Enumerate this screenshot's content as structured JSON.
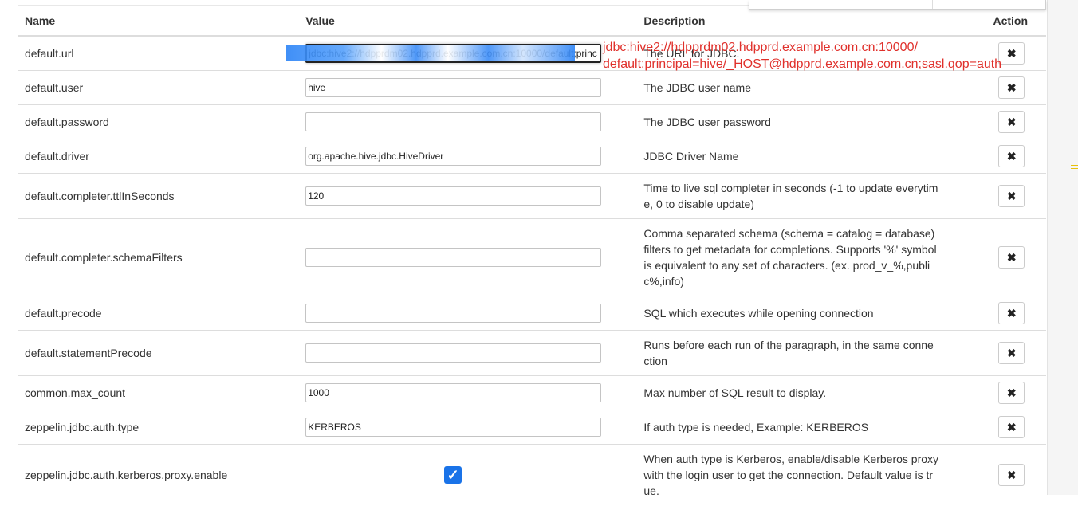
{
  "header": {
    "name": "Name",
    "value": "Value",
    "description": "Description",
    "action": "Action"
  },
  "rows": [
    {
      "name": "default.url",
      "value": "jdbc:hive2://hdpprdm02.hdpprd.example.com.cn:10000/default;princ",
      "description": "The URL for JDBC."
    },
    {
      "name": "default.user",
      "value": "hive",
      "description": "The JDBC user name"
    },
    {
      "name": "default.password",
      "value": "",
      "description": "The JDBC user password"
    },
    {
      "name": "default.driver",
      "value": "org.apache.hive.jdbc.HiveDriver",
      "description": "JDBC Driver Name"
    },
    {
      "name": "default.completer.ttlInSeconds",
      "value": "120",
      "description": "Time to live sql completer in seconds (-1 to update everytime, 0 to disable update)"
    },
    {
      "name": "default.completer.schemaFilters",
      "value": "",
      "description": "Comma separated schema (schema = catalog = database) filters to get metadata for completions. Supports '%' symbol is equivalent to any set of characters. (ex. prod_v_%,public%,info)"
    },
    {
      "name": "default.precode",
      "value": "",
      "description": "SQL which executes while opening connection"
    },
    {
      "name": "default.statementPrecode",
      "value": "",
      "description": "Runs before each run of the paragraph, in the same connection"
    },
    {
      "name": "common.max_count",
      "value": "1000",
      "description": "Max number of SQL result to display."
    },
    {
      "name": "zeppelin.jdbc.auth.type",
      "value": "KERBEROS",
      "description": "If auth type is needed, Example: KERBEROS"
    },
    {
      "name": "zeppelin.jdbc.auth.kerberos.proxy.enable",
      "checked": true,
      "description": "When auth type is Kerberos, enable/disable Kerberos proxy with the login user to get the connection. Default value is true."
    }
  ],
  "action_icon": "close-icon",
  "annotation": {
    "line1": "jdbc:hive2://hdpprdm02.hdpprd.example.com.cn:10000/",
    "line2": "default;principal=hive/_HOST@hdpprd.example.com.cn;sasl.qop=auth",
    "color": "#e0302b"
  },
  "colors": {
    "checkbox": "#1a73e8",
    "annotation": "#e0302b"
  }
}
